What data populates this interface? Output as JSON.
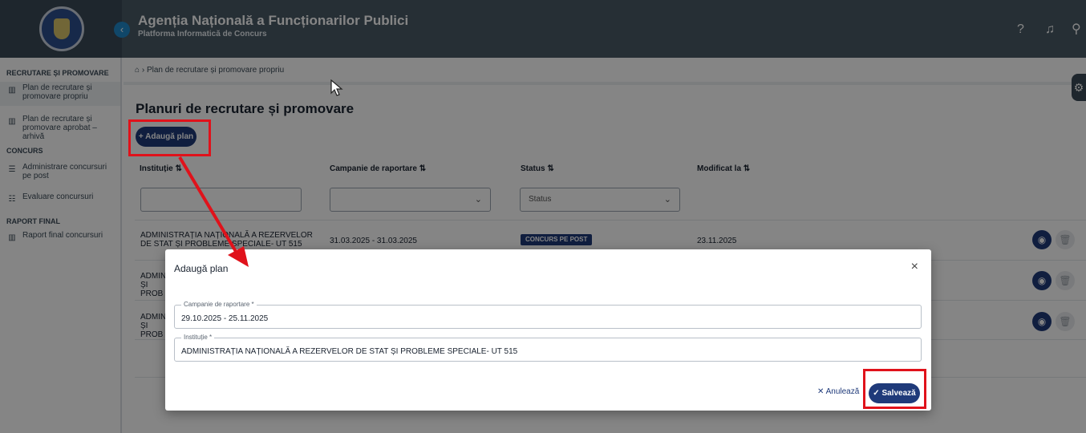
{
  "header": {
    "title": "Agenția Națională a Funcționarilor Publici",
    "subtitle": "Platforma Informatică de Concurs"
  },
  "sidebar": {
    "sections": [
      {
        "title": "RECRUTARE ȘI PROMOVARE",
        "items": [
          {
            "label": "Plan de recrutare și promovare propriu",
            "icon": "map-icon",
            "active": true
          },
          {
            "label": "Plan de recrutare și promovare aprobat – arhivă",
            "icon": "map-icon",
            "active": false
          }
        ]
      },
      {
        "title": "CONCURS",
        "items": [
          {
            "label": "Administrare concursuri pe post",
            "icon": "list-icon",
            "active": false
          },
          {
            "label": "Evaluare concursuri",
            "icon": "checklist-icon",
            "active": false
          }
        ]
      },
      {
        "title": "RAPORT FINAL",
        "items": [
          {
            "label": "Raport final concursuri",
            "icon": "map-icon",
            "active": false
          }
        ]
      }
    ]
  },
  "breadcrumb": "Plan de recrutare și promovare propriu",
  "page": {
    "title": "Planuri de recrutare și promovare",
    "add_button": "Adaugă plan"
  },
  "table": {
    "columns": [
      "Instituție",
      "Campanie de raportare",
      "Status",
      "Modificat la"
    ],
    "filters": {
      "institutie": "",
      "campanie": "",
      "status_placeholder": "Status"
    },
    "rows": [
      {
        "institutie": "ADMINISTRAȚIA NAȚIONALĂ A REZERVELOR DE STAT ȘI PROBLEME SPECIALE- UT 515",
        "campanie": "31.03.2025 - 31.03.2025",
        "status": "CONCURS PE POST",
        "modificat": "23.11.2025"
      },
      {
        "institutie": "ADMINI ȘI PROB",
        "campanie": "",
        "status": "",
        "modificat": ""
      },
      {
        "institutie": "ADMINI ȘI PROB",
        "campanie": "",
        "status": "",
        "modificat": ""
      }
    ]
  },
  "modal": {
    "title": "Adaugă plan",
    "campanie_label": "Campanie de raportare *",
    "campanie_value": "29.10.2025 - 25.11.2025",
    "institutie_label": "Instituție *",
    "institutie_value": "ADMINISTRAȚIA NAȚIONALĂ A REZERVELOR DE STAT ȘI PROBLEME SPECIALE- UT 515",
    "cancel_label": "Anulează",
    "save_label": "Salvează"
  },
  "colors": {
    "primary": "#1f3a7a",
    "header_bg": "#4a5a66",
    "highlight": "#e0121b"
  }
}
